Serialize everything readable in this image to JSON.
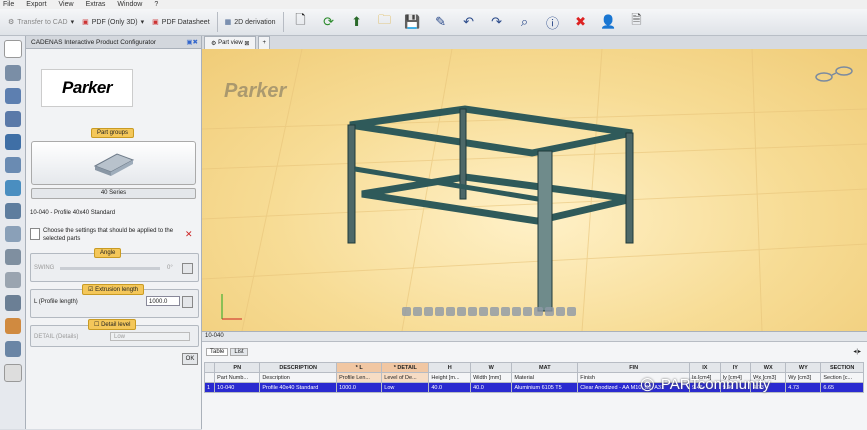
{
  "menu": [
    "File",
    "Export",
    "View",
    "Extras",
    "Window",
    "?"
  ],
  "toolbar": {
    "transfer_cad": "Transfer to CAD",
    "pdf_3d": "PDF (Only 3D)",
    "pdf_datasheet": "PDF Datasheet",
    "derivation_2d": "2D derivation"
  },
  "panel": {
    "title": "CADENAS Interactive Product Configurator",
    "logo_text": "Parker",
    "part_groups": "Part groups",
    "series": "40 Series",
    "product": "10-040 - Profile 40x40 Standard",
    "instruction": "Choose the settings that should be applied to the selected parts",
    "angle_label": "Angle",
    "swing_label": "SWING",
    "swing_value": "0°",
    "extrusion_label": "Extrusion length",
    "length_label": "L (Profile length)",
    "length_value": "1000.0",
    "detail_label": "Detail level",
    "detail_field": "DETAIL (Details)",
    "detail_value": "Low",
    "ok": "OK"
  },
  "viewport": {
    "tab_label": "Part view",
    "logo_text": "Parker",
    "part_id": "10-040"
  },
  "table": {
    "tabs": [
      "Table",
      "List"
    ],
    "headers": [
      "",
      "PN",
      "DESCRIPTION",
      "* L",
      "* DETAIL",
      "H",
      "W",
      "MAT",
      "FIN",
      "IX",
      "IY",
      "WX",
      "WY",
      "SECTION"
    ],
    "subheaders": [
      "",
      "Part Numb...",
      "Description",
      "Profile Len...",
      "Level of De...",
      "Height [m...",
      "Width [mm]",
      "Material",
      "Finish",
      "Ix [cm4]",
      "Iy [cm4]",
      "Wx [cm3]",
      "Wy [cm3]",
      "Section [c..."
    ],
    "row": [
      "1",
      "10-040",
      "Profile 40x40 Standard",
      "1000.0",
      "Low",
      "40.0",
      "40.0",
      "Aluminium 6105 T5",
      "Clear Anodized - AA M10, C2, A31",
      "9.46",
      "9.46",
      "4.73",
      "4.73",
      "6.65"
    ]
  },
  "watermark": "PARTcommunity",
  "colors": {
    "accent": "#f4c75a",
    "selected_row": "#2a2ad0",
    "frame": "#2f5a5a"
  }
}
